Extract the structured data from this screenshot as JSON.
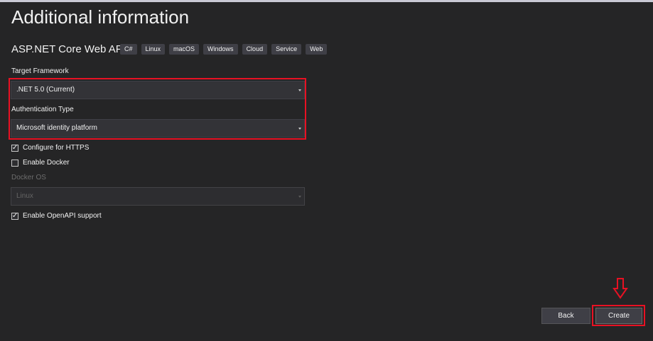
{
  "title": "Additional information",
  "project": {
    "name": "ASP.NET Core Web API",
    "tags": [
      "C#",
      "Linux",
      "macOS",
      "Windows",
      "Cloud",
      "Service",
      "Web"
    ]
  },
  "target_framework": {
    "label": "Target Framework",
    "value": ".NET 5.0 (Current)"
  },
  "authentication": {
    "label": "Authentication Type",
    "value": "Microsoft identity platform"
  },
  "options": {
    "https": {
      "label": "Configure for HTTPS",
      "checked": true
    },
    "docker": {
      "label": "Enable Docker",
      "checked": false
    },
    "openapi": {
      "label": "Enable OpenAPI support",
      "checked": true
    }
  },
  "docker_os": {
    "label": "Docker OS",
    "value": "Linux",
    "disabled": true
  },
  "buttons": {
    "back": "Back",
    "create": "Create"
  },
  "icons": {
    "check": "✓"
  },
  "colors": {
    "background": "#252526",
    "highlight": "#e81123",
    "control": "#333337"
  }
}
